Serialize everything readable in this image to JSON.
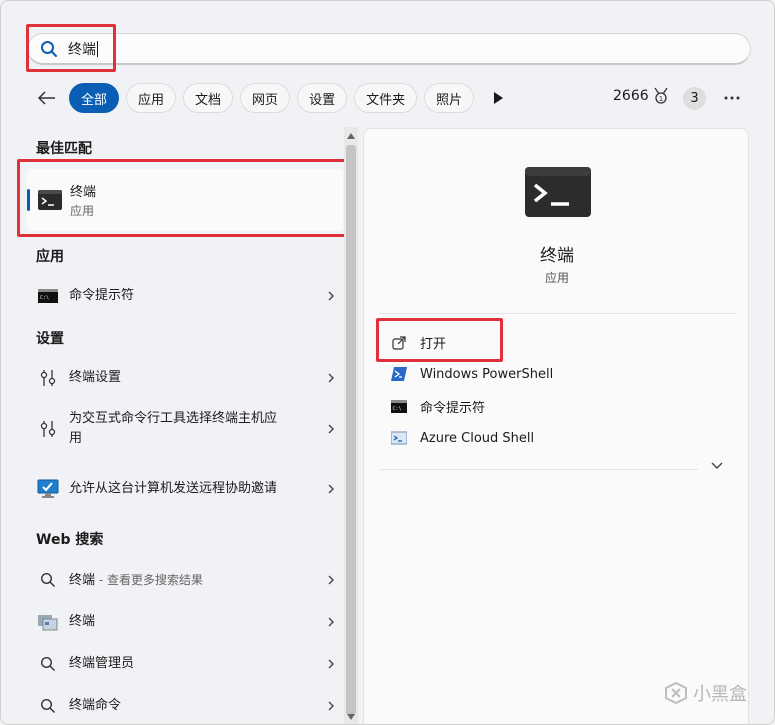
{
  "search": {
    "query": "终端"
  },
  "filters": {
    "items": [
      {
        "label": "全部",
        "active": true
      },
      {
        "label": "应用",
        "active": false
      },
      {
        "label": "文档",
        "active": false
      },
      {
        "label": "网页",
        "active": false
      },
      {
        "label": "设置",
        "active": false
      },
      {
        "label": "文件夹",
        "active": false
      },
      {
        "label": "照片",
        "active": false
      }
    ],
    "points": "2666",
    "avatar": "3"
  },
  "left": {
    "best_match_title": "最佳匹配",
    "best_match": {
      "name": "终端",
      "type": "应用"
    },
    "apps_title": "应用",
    "apps": [
      {
        "label": "命令提示符"
      }
    ],
    "settings_title": "设置",
    "settings": [
      {
        "label": "终端设置"
      },
      {
        "label": "为交互式命令行工具选择终端主机应用"
      },
      {
        "label": "允许从这台计算机发送远程协助邀请"
      }
    ],
    "web_title": "Web 搜索",
    "web": [
      {
        "label": "终端",
        "suffix": " - 查看更多搜索结果"
      },
      {
        "label": "终端",
        "suffix": ""
      },
      {
        "label": "终端管理员",
        "suffix": ""
      },
      {
        "label": "终端命令",
        "suffix": ""
      }
    ]
  },
  "right": {
    "app_name": "终端",
    "app_type": "应用",
    "actions": [
      {
        "label": "打开",
        "icon": "open-external-icon"
      },
      {
        "label": "Windows PowerShell",
        "icon": "powershell-icon"
      },
      {
        "label": "命令提示符",
        "icon": "cmd-icon"
      },
      {
        "label": "Azure Cloud Shell",
        "icon": "azure-cloud-shell-icon"
      }
    ]
  },
  "watermark": "小黑盒",
  "colors": {
    "accent": "#0a5fb4",
    "highlight": "#e0303a"
  }
}
